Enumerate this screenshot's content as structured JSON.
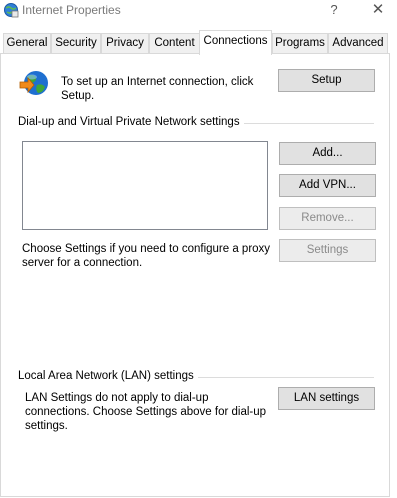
{
  "window": {
    "title": "Internet Properties",
    "help_glyph": "?",
    "close_glyph": "✕"
  },
  "tabs": [
    {
      "label": "General"
    },
    {
      "label": "Security"
    },
    {
      "label": "Privacy"
    },
    {
      "label": "Content"
    },
    {
      "label": "Connections",
      "active": true
    },
    {
      "label": "Programs"
    },
    {
      "label": "Advanced"
    }
  ],
  "setup": {
    "text": "To set up an Internet connection, click Setup.",
    "button": "Setup"
  },
  "dialup": {
    "group_label": "Dial-up and Virtual Private Network settings",
    "add_button": "Add...",
    "add_vpn_button": "Add VPN...",
    "remove_button": "Remove...",
    "settings_button": "Settings",
    "proxy_text": "Choose Settings if you need to configure a proxy server for a connection."
  },
  "lan": {
    "group_label": "Local Area Network (LAN) settings",
    "text": "LAN Settings do not apply to dial-up connections. Choose Settings above for dial-up settings.",
    "button": "LAN settings"
  },
  "colors": {
    "globe_blue": "#1e6fd0",
    "globe_green": "#3fa53a",
    "arrow_orange": "#f08a1c"
  }
}
